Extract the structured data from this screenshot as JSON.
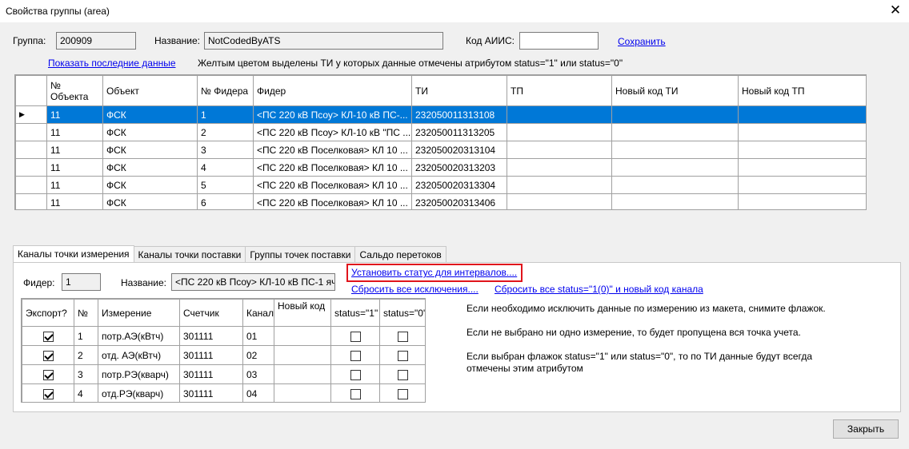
{
  "window": {
    "title": "Свойства группы (area)",
    "close_glyph": "✕"
  },
  "header": {
    "group_label": "Группа:",
    "group_value": "200909",
    "name_label": "Название:",
    "name_value": "NotCodedByATS",
    "code_label": "Код АИИС:",
    "code_value": "",
    "save_link": "Сохранить",
    "show_data_link": "Показать последние данные",
    "hint": "Желтым цветом выделены ТИ у которых данные отмечены атрибутом status=\"1\" или status=\"0\""
  },
  "main_grid": {
    "columns": [
      "№ Объекта",
      "Объект",
      "№ Фидера",
      "Фидер",
      "ТИ",
      "ТП",
      "Новый код ТИ",
      "Новый код ТП"
    ],
    "selected_marker": "▶",
    "rows": [
      {
        "obj": "11",
        "object": "ФСК",
        "feeder_no": "1",
        "feeder": "<ПС 220 кВ Псоу> КЛ-10 кВ ПС-...",
        "ti": "232050011313108",
        "tp": "",
        "new_ti": "",
        "new_tp": ""
      },
      {
        "obj": "11",
        "object": "ФСК",
        "feeder_no": "2",
        "feeder": "<ПС 220 кВ Псоу> КЛ-10 кВ \"ПС ...",
        "ti": "232050011313205",
        "tp": "",
        "new_ti": "",
        "new_tp": ""
      },
      {
        "obj": "11",
        "object": "ФСК",
        "feeder_no": "3",
        "feeder": "<ПС 220 кВ  Поселковая> КЛ 10 ...",
        "ti": "232050020313104",
        "tp": "",
        "new_ti": "",
        "new_tp": ""
      },
      {
        "obj": "11",
        "object": "ФСК",
        "feeder_no": "4",
        "feeder": "<ПС 220 кВ  Поселковая> КЛ 10 ...",
        "ti": "232050020313203",
        "tp": "",
        "new_ti": "",
        "new_tp": ""
      },
      {
        "obj": "11",
        "object": "ФСК",
        "feeder_no": "5",
        "feeder": "<ПС 220 кВ  Поселковая> КЛ 10 ...",
        "ti": "232050020313304",
        "tp": "",
        "new_ti": "",
        "new_tp": ""
      },
      {
        "obj": "11",
        "object": "ФСК",
        "feeder_no": "6",
        "feeder": "<ПС 220 кВ  Поселковая> КЛ 10 ...",
        "ti": "232050020313406",
        "tp": "",
        "new_ti": "",
        "new_tp": ""
      }
    ]
  },
  "tabs": [
    "Каналы точки измерения",
    "Каналы точки поставки",
    "Группы точек поставки",
    "Сальдо перетоков"
  ],
  "panel": {
    "feeder_label": "Фидер:",
    "feeder_value": "1",
    "name_label": "Название:",
    "name_value": "<ПС 220 кВ Псоу> КЛ-10 кВ ПС-1 яч",
    "link_set_status": "Установить статус для интервалов....",
    "link_reset_exceptions": "Сбросить все исключения....",
    "link_reset_status": "Сбросить все status=\"1(0)\" и новый код канала",
    "channels": {
      "columns": [
        "Экспорт?",
        "№",
        "Измерение",
        "Счетчик",
        "Канал",
        "Новый код",
        "status=\"1\"",
        "status=\"0\""
      ],
      "rows": [
        {
          "export": true,
          "n": "1",
          "measure": "потр.АЭ(кВтч)",
          "meter": "301111",
          "channel": "01",
          "new_code": "",
          "s1": false,
          "s0": false
        },
        {
          "export": true,
          "n": "2",
          "measure": "отд. АЭ(кВтч)",
          "meter": "301111",
          "channel": "02",
          "new_code": "",
          "s1": false,
          "s0": false
        },
        {
          "export": true,
          "n": "3",
          "measure": "потр.РЭ(кварч)",
          "meter": "301111",
          "channel": "03",
          "new_code": "",
          "s1": false,
          "s0": false
        },
        {
          "export": true,
          "n": "4",
          "measure": "отд.РЭ(кварч)",
          "meter": "301111",
          "channel": "04",
          "new_code": "",
          "s1": false,
          "s0": false
        }
      ]
    },
    "info": [
      "Если необходимо исключить данные по измерению из макета, снимите флажок.",
      "Если не выбрано ни одно измерение, то будет пропущена вся точка учета.",
      "Если выбран флажок status=\"1\" или status=\"0\", то по ТИ данные будут всегда отмечены этим атрибутом"
    ]
  },
  "footer": {
    "close_button": "Закрыть"
  },
  "colors": {
    "selection": "#0078d7",
    "link": "#0000ee",
    "highlight": "#e0141c"
  }
}
